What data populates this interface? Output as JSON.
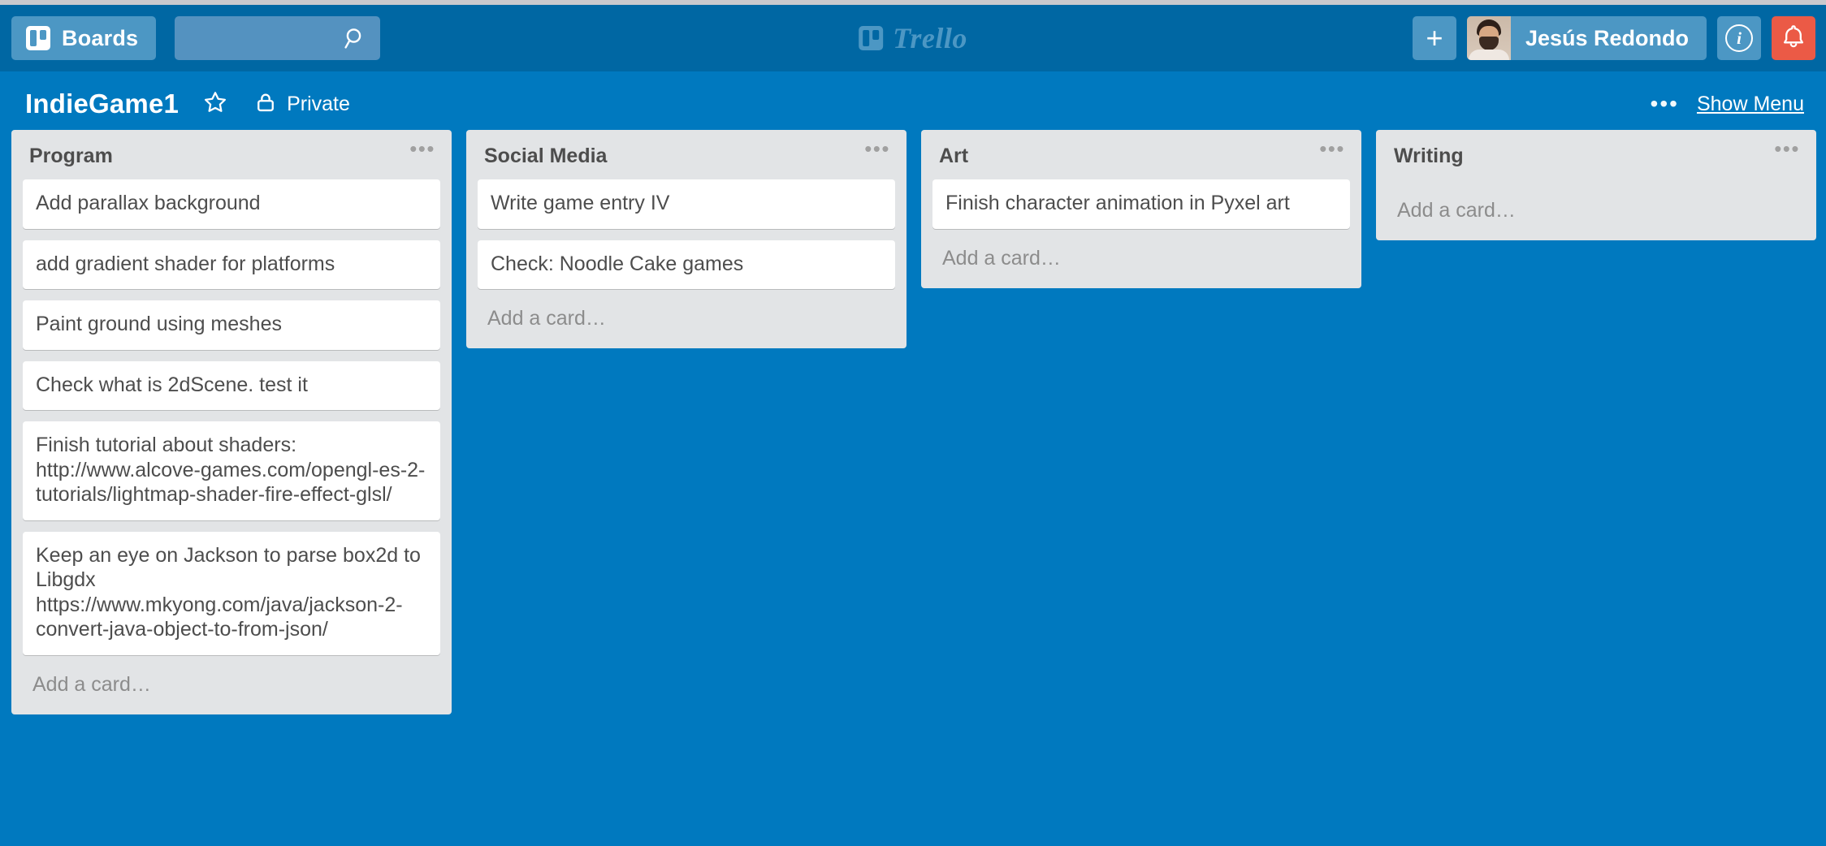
{
  "colors": {
    "header_bar": "#0067a3",
    "board_background": "#0079bf",
    "button_blue": "#4c97c4",
    "search_blue": "#5492c0",
    "notification_red": "#eb5a46",
    "list_background": "#e2e4e6",
    "card_white": "#ffffff",
    "card_text": "#4d4d4d",
    "placeholder_grey": "#8c8c8c",
    "os_strip": "#c9c9cd"
  },
  "header": {
    "boards_button_label": "Boards",
    "boards_icon": "trello-board-icon",
    "search_placeholder": "",
    "search_value": "",
    "search_icon": "search-icon",
    "logo_text": "Trello",
    "logo_icon": "trello-board-icon",
    "add_button_icon": "plus-icon",
    "member_name": "Jesús Redondo",
    "member_avatar_icon": "user-avatar",
    "info_button_icon": "info-icon",
    "notifications_button_icon": "bell-icon"
  },
  "board_bar": {
    "title": "IndieGame1",
    "star_icon": "star-outline-icon",
    "privacy_icon": "lock-icon",
    "privacy_label": "Private",
    "overflow_icon": "ellipsis-icon",
    "show_menu_label": "Show Menu"
  },
  "lists": [
    {
      "title": "Program",
      "overflow_icon": "ellipsis-icon",
      "add_card_label": "Add a card…",
      "cards": [
        {
          "text": "Add parallax background"
        },
        {
          "text": "add gradient shader for platforms"
        },
        {
          "text": "Paint ground using meshes"
        },
        {
          "text": "Check what is 2dScene. test it"
        },
        {
          "text": "Finish tutorial about shaders: http://www.alcove-games.com/opengl-es-2-tutorials/lightmap-shader-fire-effect-glsl/"
        },
        {
          "text": "Keep an eye on Jackson to parse box2d to Libgdx https://www.mkyong.com/java/jackson-2-convert-java-object-to-from-json/"
        }
      ]
    },
    {
      "title": "Social Media",
      "overflow_icon": "ellipsis-icon",
      "add_card_label": "Add a card…",
      "cards": [
        {
          "text": "Write game entry IV"
        },
        {
          "text": "Check: Noodle Cake games"
        }
      ]
    },
    {
      "title": "Art",
      "overflow_icon": "ellipsis-icon",
      "add_card_label": "Add a card…",
      "cards": [
        {
          "text": "Finish character animation in Pyxel art"
        }
      ]
    },
    {
      "title": "Writing",
      "overflow_icon": "ellipsis-icon",
      "add_card_label": "Add a card…",
      "cards": []
    }
  ]
}
